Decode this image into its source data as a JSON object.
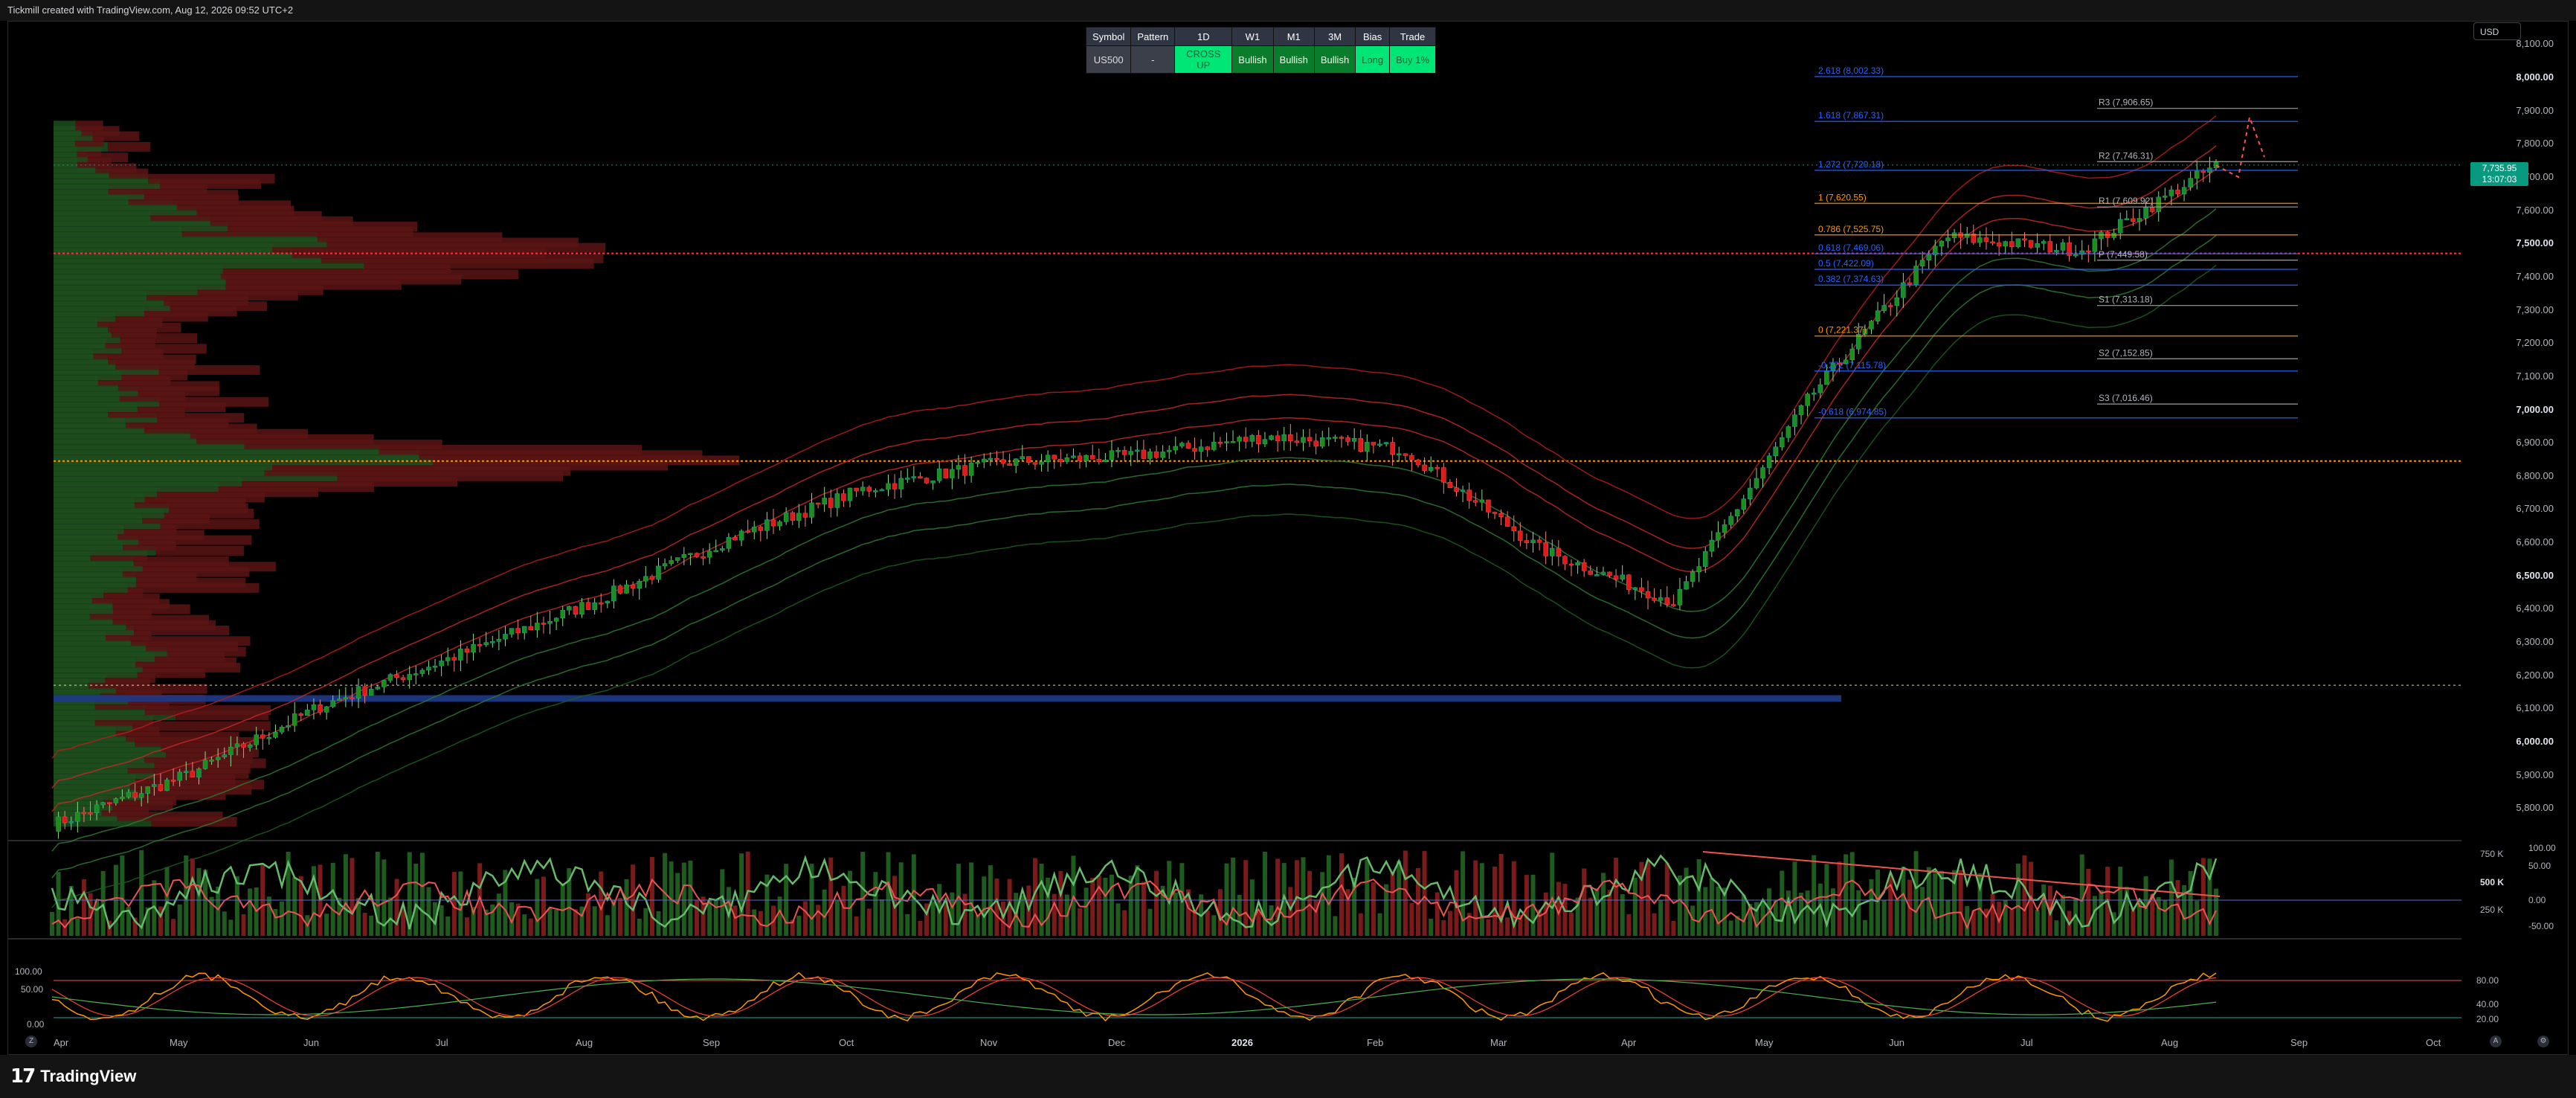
{
  "header": {
    "caption": "Tickmill created with TradingView.com, Aug 12, 2026 09:52 UTC+2"
  },
  "signal_table": {
    "headers": [
      "Symbol",
      "Pattern",
      "1D",
      "W1",
      "M1",
      "3M",
      "Bias",
      "Trade"
    ],
    "values": [
      "US500",
      "-",
      "CROSS UP",
      "Bullish",
      "Bullish",
      "Bullish",
      "Long",
      "Buy 1%"
    ]
  },
  "price_scale": {
    "currency": "USD",
    "ticks": [
      "8,100.00",
      "8,000.00",
      "7,900.00",
      "7,800.00",
      "7,700.00",
      "7,600.00",
      "7,500.00",
      "7,400.00",
      "7,300.00",
      "7,200.00",
      "7,100.00",
      "7,000.00",
      "6,900.00",
      "6,800.00",
      "6,700.00",
      "6,600.00",
      "6,500.00",
      "6,400.00",
      "6,300.00",
      "6,200.00",
      "6,100.00",
      "6,000.00",
      "5,900.00",
      "5,800.00"
    ],
    "current_price": "7,735.95",
    "countdown": "13:07:03"
  },
  "pivots": {
    "fib_levels": [
      {
        "label": "2.618 (8,002.33)",
        "color": "#2962ff"
      },
      {
        "label": "1.618 (7,867.31)",
        "color": "#2962ff"
      },
      {
        "label": "1.272 (7,720.18)",
        "color": "#2962ff"
      },
      {
        "label": "1 (7,620.55)",
        "color": "#ff9800"
      },
      {
        "label": "0.786 (7,525.75)",
        "color": "#ff9800"
      },
      {
        "label": "0.618 (7,469.06)",
        "color": "#2962ff"
      },
      {
        "label": "0.5 (7,422.09)",
        "color": "#2962ff"
      },
      {
        "label": "0.382 (7,374.63)",
        "color": "#2962ff"
      },
      {
        "label": "0 (7,221.37)",
        "color": "#ff9800"
      },
      {
        "label": "-0.272 (7,115.78)",
        "color": "#2962ff"
      },
      {
        "label": "-0.618 (6,974.85)",
        "color": "#2962ff"
      }
    ],
    "pp_levels": [
      {
        "label": "R3 (7,906.65)"
      },
      {
        "label": "R2 (7,746.31)"
      },
      {
        "label": "R1 (7,609.92)"
      },
      {
        "label": "P (7,449.58)"
      },
      {
        "label": "S1 (7,313.18)"
      },
      {
        "label": "S2 (7,152.85)"
      },
      {
        "label": "S3 (7,016.46)"
      }
    ]
  },
  "volume_panel": {
    "right_ticks": [
      "750 K",
      "500 K",
      "250 K"
    ],
    "osc_ticks": [
      "100.00",
      "50.00",
      "0.00",
      "-50.00"
    ]
  },
  "stoch_panel": {
    "left_ticks": [
      "100.00",
      "50.00",
      "0.00"
    ],
    "right_ticks": [
      "80.00",
      "40.00",
      "20.00"
    ]
  },
  "time_axis": {
    "labels": [
      "Apr",
      "May",
      "Jun",
      "Jul",
      "Aug",
      "Sep",
      "Oct",
      "Nov",
      "Dec",
      "2026",
      "Feb",
      "Mar",
      "Apr",
      "May",
      "Jun",
      "Jul",
      "Aug",
      "Sep",
      "Oct"
    ]
  },
  "footer": {
    "brand": "TradingView"
  },
  "chart_data": {
    "type": "candlestick",
    "symbol": "US500",
    "price_range": [
      5750,
      8100
    ],
    "months": [
      "Apr",
      "May",
      "Jun",
      "Jul",
      "Aug",
      "Sep",
      "Oct",
      "Nov",
      "Dec",
      "Jan",
      "Feb",
      "Mar",
      "Apr",
      "May",
      "Jun",
      "Jul",
      "Aug"
    ],
    "monthly_close": [
      5750,
      5900,
      6110,
      6260,
      6420,
      6610,
      6760,
      6840,
      6860,
      6920,
      6880,
      6580,
      6420,
      7040,
      7520,
      7480,
      7736
    ],
    "current_price": 7735.95,
    "high_volume_nodes": [
      7470,
      6845
    ],
    "support_zone": [
      6120,
      6140
    ],
    "projection": "dashed path higher toward ~7,880 then lower"
  }
}
